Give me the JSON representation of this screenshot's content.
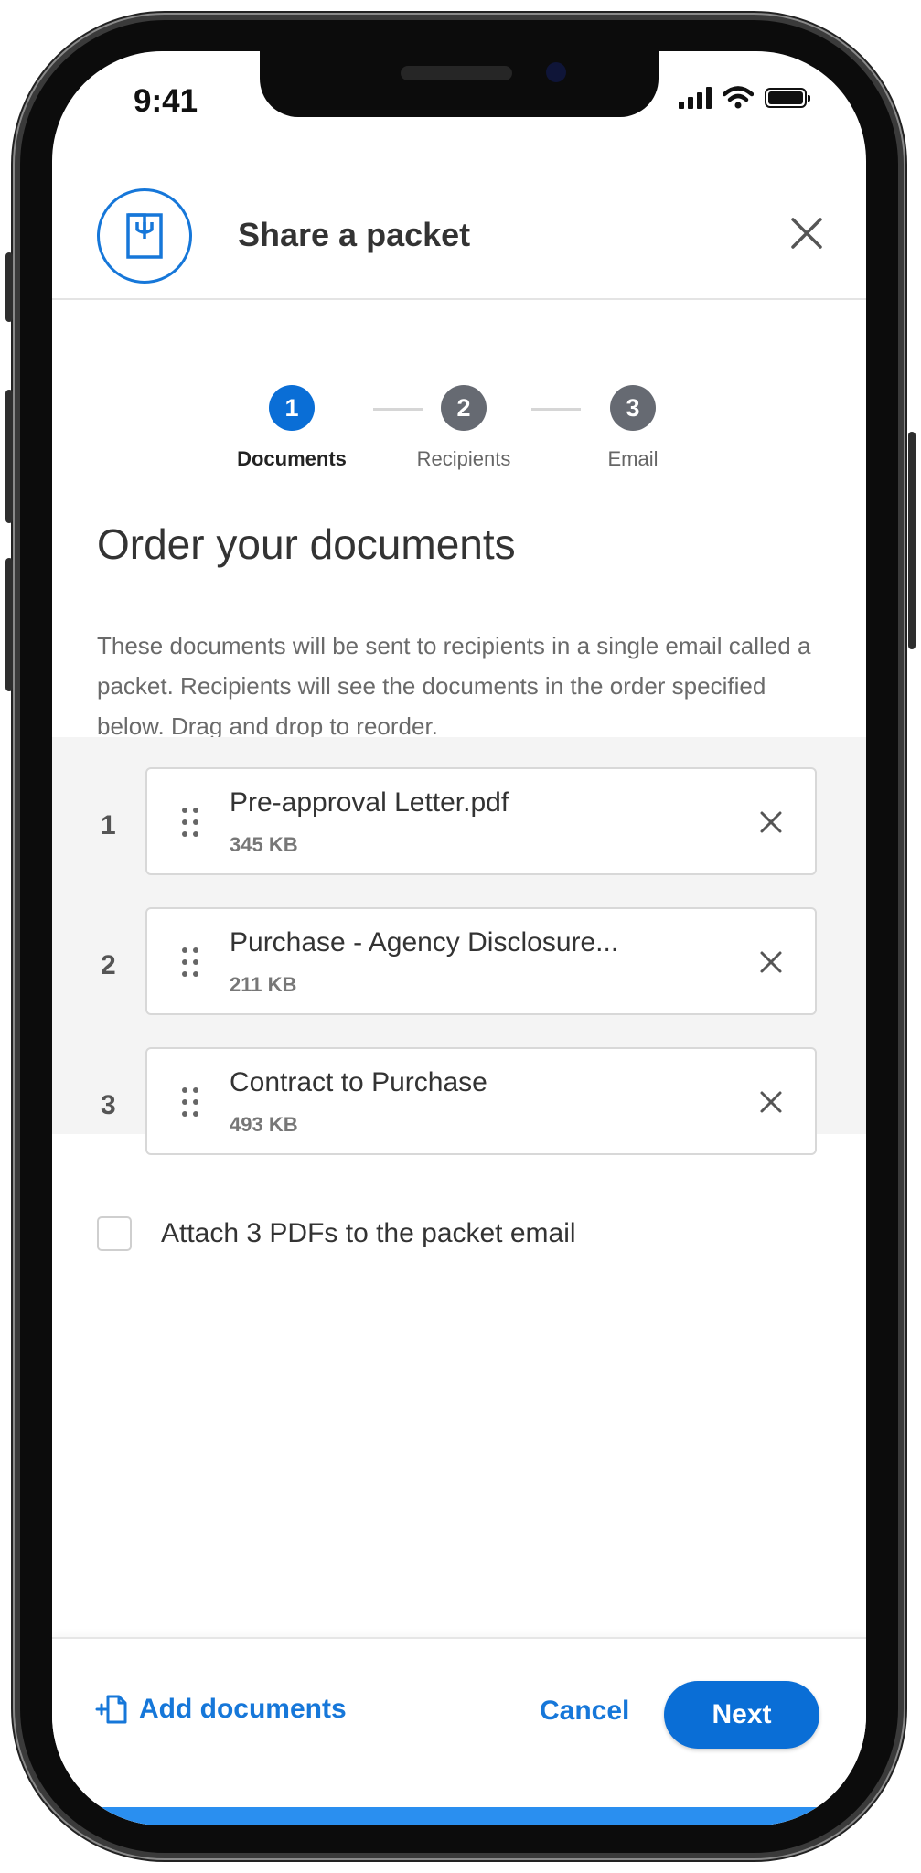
{
  "status_bar": {
    "time": "9:41"
  },
  "header": {
    "title": "Share a packet",
    "logo_icon": "packet-icon",
    "close_icon": "close-icon"
  },
  "steps": [
    {
      "number": "1",
      "label": "Documents",
      "state": "active",
      "color": "#0a6ed6"
    },
    {
      "number": "2",
      "label": "Recipients",
      "state": "inactive",
      "color": "#666a72"
    },
    {
      "number": "3",
      "label": "Email",
      "state": "inactive",
      "color": "#666a72"
    }
  ],
  "main": {
    "heading": "Order your documents",
    "description": "These documents will be sent to recipients in a single email called a packet. Recipients will see the documents in the order specified below. Drag and drop to reorder."
  },
  "documents": [
    {
      "index": "1",
      "name": "Pre-approval Letter.pdf",
      "size": "345 KB"
    },
    {
      "index": "2",
      "name": "Purchase - Agency Disclosure...",
      "size": "211 KB"
    },
    {
      "index": "3",
      "name": "Contract to Purchase",
      "size": "493 KB"
    }
  ],
  "attach_checkbox": {
    "label": "Attach 3 PDFs to the packet email",
    "checked": false
  },
  "footer": {
    "add_documents": "Add documents",
    "cancel": "Cancel",
    "next": "Next"
  },
  "colors": {
    "accent": "#0a6ed6",
    "link": "#1677d9",
    "inactive_step": "#666a72"
  }
}
